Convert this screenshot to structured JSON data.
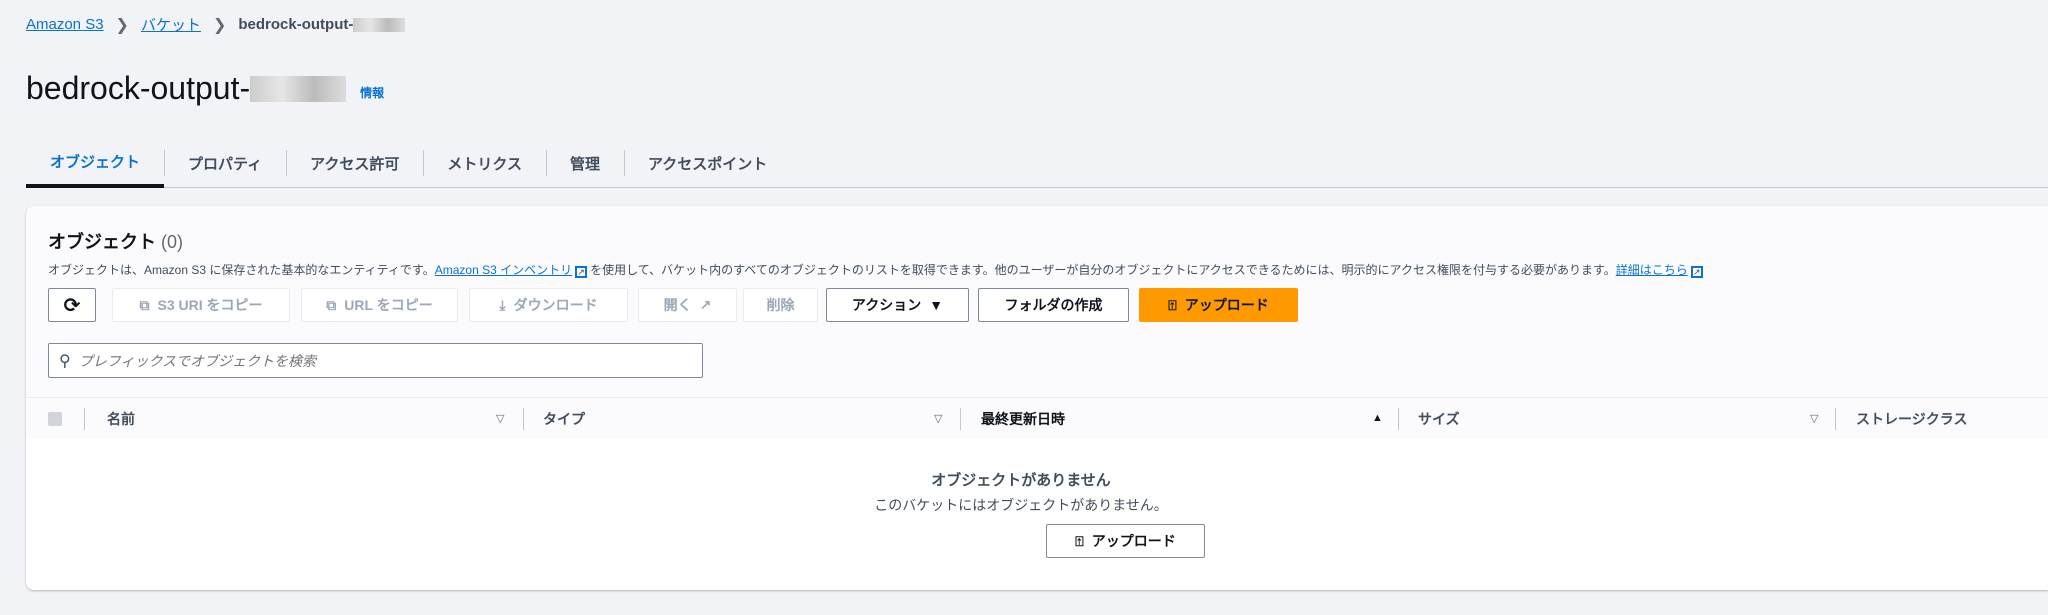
{
  "breadcrumb": {
    "items": [
      "Amazon S3",
      "バケット"
    ],
    "current": "bedrock-output-"
  },
  "header": {
    "title": "bedrock-output-",
    "info": "情報"
  },
  "tabs": [
    "オブジェクト",
    "プロパティ",
    "アクセス許可",
    "メトリクス",
    "管理",
    "アクセスポイント"
  ],
  "panel": {
    "title": "オブジェクト",
    "count": "(0)",
    "desc1": "オブジェクトは、Amazon S3 に保存された基本的なエンティティです。",
    "desc_link1": "Amazon S3 インベントリ",
    "desc2": "を使用して、バケット内のすべてのオブジェクトのリストを取得できます。他のユーザーが自分のオブジェクトにアクセスできるためには、明示的にアクセス権限を付与する必要があります。",
    "desc_link2": "詳細はこちら",
    "buttons": {
      "copy_s3_uri": "S3 URI をコピー",
      "copy_url": "URL をコピー",
      "download": "ダウンロード",
      "open": "開く",
      "delete": "削除",
      "actions": "アクション",
      "create_folder": "フォルダの作成",
      "upload": "アップロード"
    },
    "search_placeholder": "プレフィックスでオブジェクトを検索",
    "columns": [
      "名前",
      "タイプ",
      "最終更新日時",
      "サイズ",
      "ストレージクラス"
    ],
    "empty": {
      "title": "オブジェクトがありません",
      "text": "このバケットにはオブジェクトがありません。",
      "button": "アップロード"
    }
  },
  "colors": {
    "accent": "#0972d3",
    "primary": "#ff9900"
  }
}
